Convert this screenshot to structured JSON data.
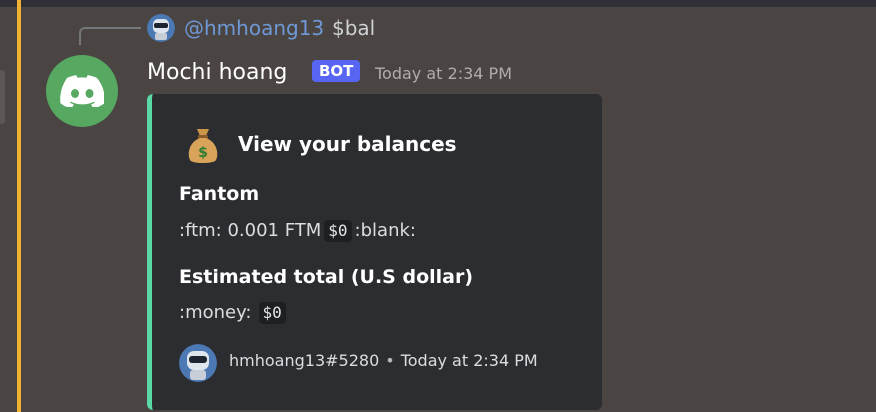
{
  "reply": {
    "mention": "@hmhoang13",
    "content": "$bal",
    "avatar_icon": "robot-avatar-icon"
  },
  "message": {
    "author": "Mochi hoang",
    "bot_tag": "BOT",
    "timestamp": "Today at 2:34 PM",
    "avatar_icon": "discord-logo-icon",
    "avatar_color": "#57a861"
  },
  "embed": {
    "accent_color": "#58d9a5",
    "icon": "money-bag-icon",
    "title": "View your balances",
    "fields": [
      {
        "name": "Fantom",
        "value_prefix": ":ftm: 0.001 FTM",
        "code": "$0",
        "value_suffix": ":blank:"
      },
      {
        "name": "Estimated total (U.S dollar)",
        "value_prefix": ":money:",
        "code": "$0"
      }
    ],
    "footer": {
      "user": "hmhoang13#5280",
      "separator": "•",
      "timestamp": "Today at 2:34 PM",
      "avatar_icon": "robot-avatar-icon"
    }
  },
  "colors": {
    "highlight_bar": "#f0b232",
    "bot_tag": "#5865f2",
    "mention": "#6f98d6"
  }
}
